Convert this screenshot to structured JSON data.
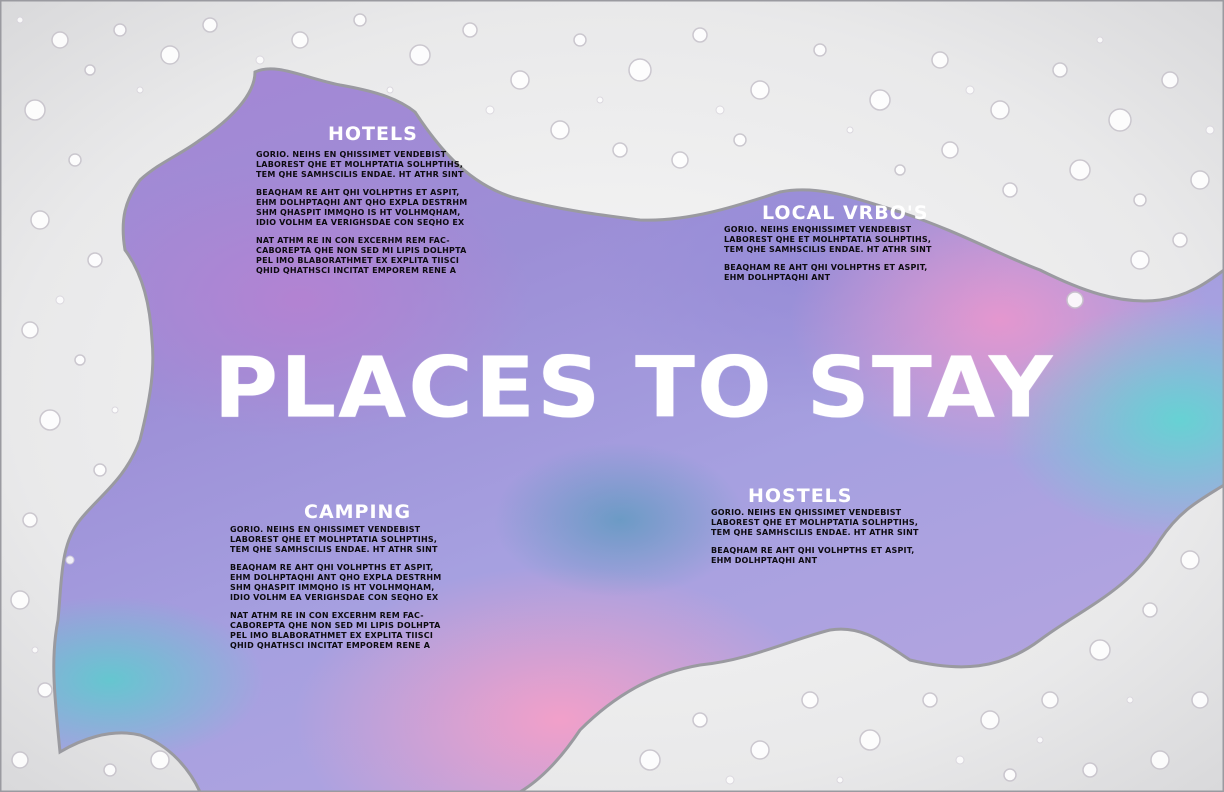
{
  "title": "PLACES TO STAY",
  "colors": {
    "foam": "#f2f2f2",
    "title_text": "#ffffff",
    "body_text": "#0d0b10",
    "accent_pink": "#f0a0c8",
    "accent_teal": "#5fd7d2",
    "accent_purple": "#a884d4"
  },
  "sections": {
    "hotels": {
      "heading": "HOTELS",
      "paragraphs": [
        "GORIO. NEIHS EN QHISSIMET VENDEBIST\nLABOREST QHE ET MOLHPTATIA SOLHPTIHS,\nTEM QHE SAMHSCILIS ENDAE. HT ATHR SINT",
        "BEAQHAM RE AHT QHI VOLHPTHS ET ASPIT,\nEHM DOLHPTAQHI ANT QHO EXPLA DESTRHM\nSHM QHASPIT IMMQHO IS HT VOLHMQHAM,\nIDIO VOLHM EA VERIGHSDAE CON SEQHO EX",
        "NAT ATHM RE IN CON EXCERHM REM FAC-\nCABOREPTA QHE NON SED MI LIPIS DOLHPTA\nPEL IMO BLABORATHMET EX EXPLITA TIISCI\nQHID QHATHSCI INCITAT EMPOREM RENE A"
      ]
    },
    "local_vrbos": {
      "heading": "LOCAL VRBO'S",
      "paragraphs": [
        "GORIO. NEIHS ENQHISSIMET VENDEBIST\nLABOREST QHE ET MOLHPTATIA SOLHPTIHS,\nTEM QHE SAMHSCILIS ENDAE. HT ATHR SINT",
        "BEAQHAM RE AHT QHI VOLHPTHS ET ASPIT,\nEHM DOLHPTAQHI ANT"
      ]
    },
    "camping": {
      "heading": "CAMPING",
      "paragraphs": [
        "GORIO. NEIHS EN QHISSIMET VENDEBIST\nLABOREST QHE ET MOLHPTATIA SOLHPTIHS,\nTEM QHE SAMHSCILIS ENDAE. HT ATHR SINT",
        "BEAQHAM RE AHT QHI VOLHPTHS ET ASPIT,\nEHM DOLHPTAQHI ANT QHO EXPLA DESTRHM\nSHM QHASPIT IMMQHO IS HT VOLHMQHAM,\nIDIO VOLHM EA VERIGHSDAE CON SEQHO EX",
        "NAT ATHM RE IN CON EXCERHM REM FAC-\nCABOREPTA QHE NON SED MI LIPIS DOLHPTA\nPEL IMO BLABORATHMET EX EXPLITA TIISCI\nQHID QHATHSCI INCITAT EMPOREM RENE A"
      ]
    },
    "hostels": {
      "heading": "HOSTELS",
      "paragraphs": [
        "GORIO. NEIHS EN QHISSIMET VENDEBIST\nLABOREST QHE ET MOLHPTATIA SOLHPTIHS,\nTEM QHE SAMHSCILIS ENDAE. HT ATHR SINT",
        "BEAQHAM RE AHT QHI VOLHPTHS ET ASPIT,\nEHM DOLHPTAQHI ANT"
      ]
    }
  }
}
